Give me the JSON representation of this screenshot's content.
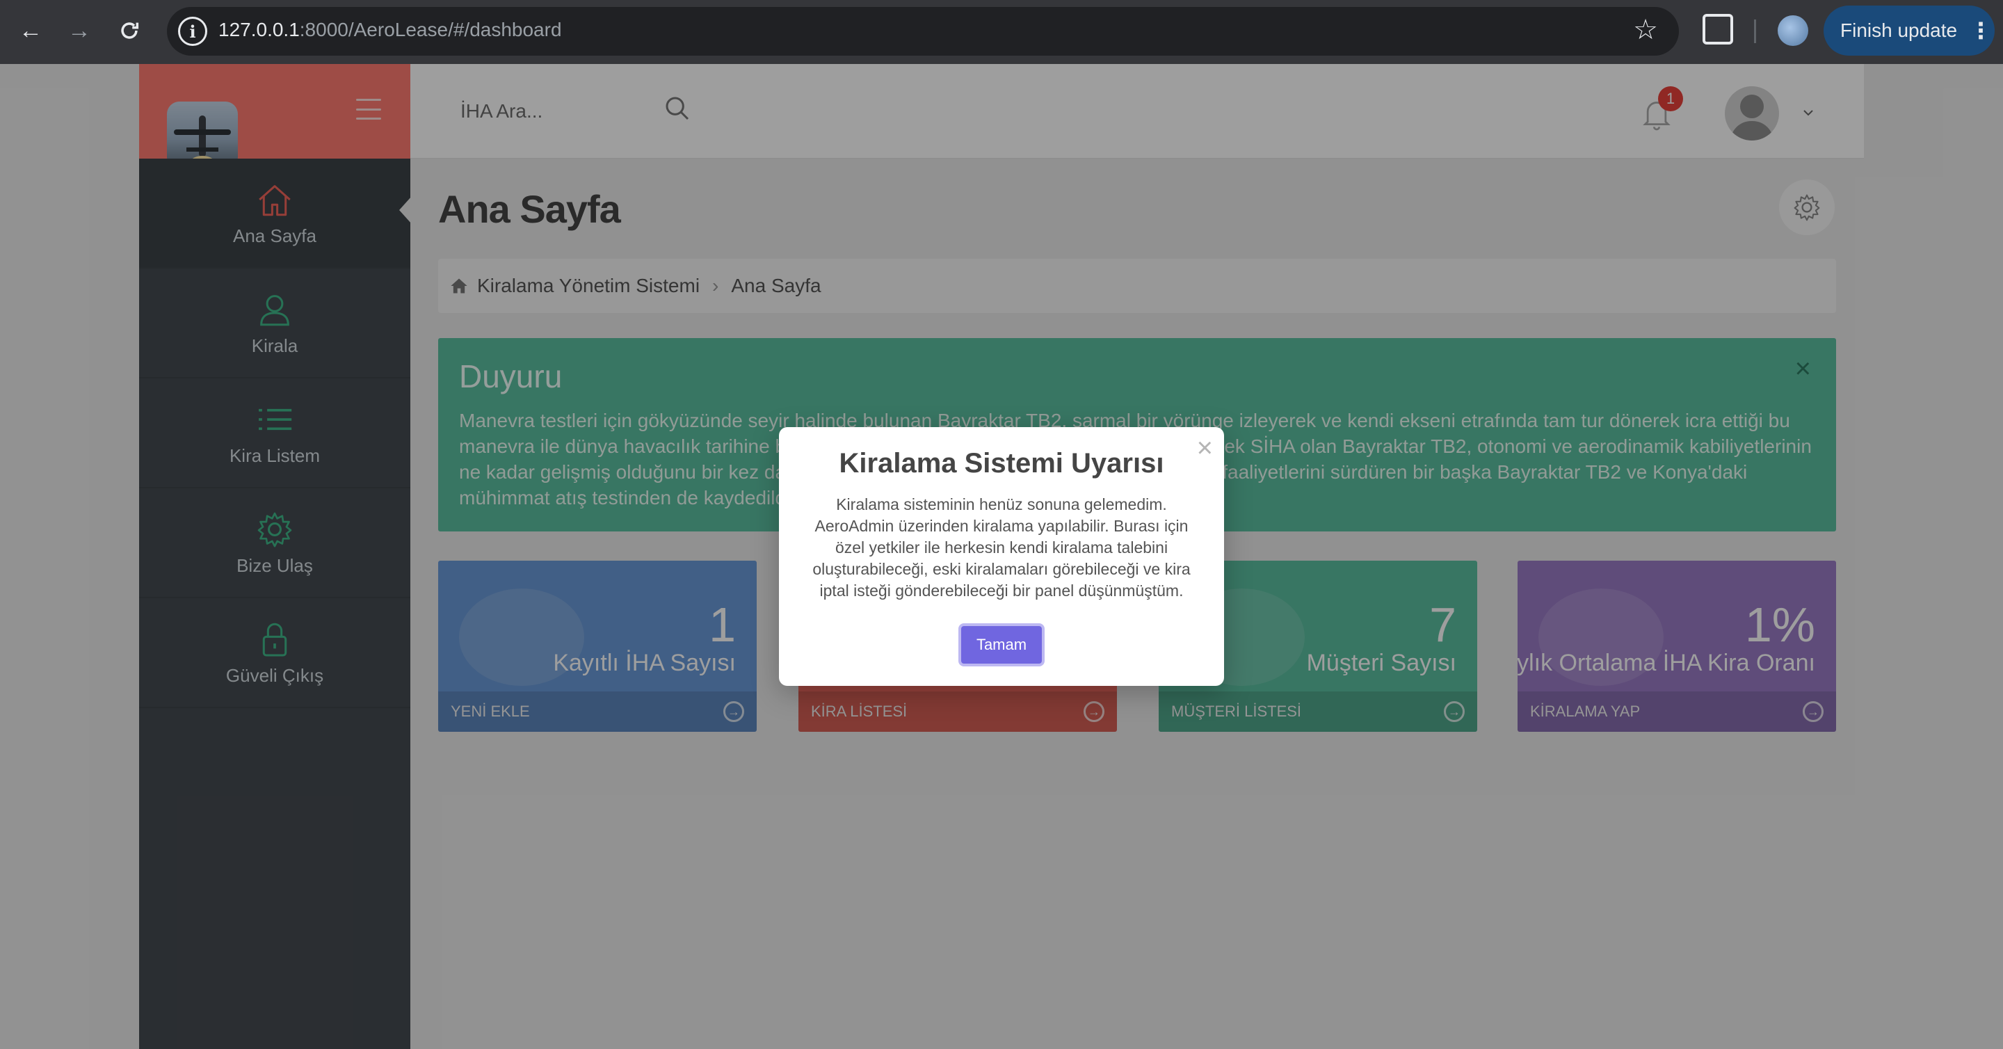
{
  "browser": {
    "url_host": "127.0.0.1",
    "url_rest": ":8000/AeroLease/#/dashboard",
    "update_label": "Finish update"
  },
  "search": {
    "placeholder": "İHA Ara..."
  },
  "notifications": {
    "count": "1"
  },
  "sidebar": {
    "items": [
      {
        "label": "Ana Sayfa",
        "icon": "home-icon",
        "active": true
      },
      {
        "label": "Kirala",
        "icon": "user-icon"
      },
      {
        "label": "Kira Listem",
        "icon": "list-icon"
      },
      {
        "label": "Bize Ulaş",
        "icon": "gear-icon"
      },
      {
        "label": "Güveli Çıkış",
        "icon": "lock-icon"
      }
    ]
  },
  "page": {
    "title": "Ana Sayfa",
    "breadcrumb": {
      "root": "Kiralama Yönetim Sistemi",
      "current": "Ana Sayfa"
    }
  },
  "notice": {
    "title": "Duyuru",
    "text": "Manevra testleri için gökyüzünde seyir halinde bulunan Bayraktar TB2, sarmal bir yörünge izleyerek ve kendi ekseni etrafında tam tur dönerek icra ettiği bu manevra ile dünya havacılık tarihine bir ilk daha yazdırdı. Bu manevrayı yapabilen ilk ve tek SİHA olan Bayraktar TB2, otonomi ve aerodinamik kabiliyetlerinin ne kadar gelişmiş olduğunu bir kez daha gösterdi. Manevranın ilgi çekici anlarını ise test faaliyetlerini sürdüren bir başka Bayraktar TB2 ve Konya'daki mühimmat atış testinden de kaydedildi."
  },
  "stats": [
    {
      "value": "1",
      "label": "Kayıtlı İHA Sayısı",
      "link": "YENİ EKLE",
      "color": "#6a9ad8"
    },
    {
      "value": "",
      "label": "",
      "link": "KİRA LİSTESİ",
      "color": "#f26b61"
    },
    {
      "value": "7",
      "label": "Müşteri Sayısı",
      "link": "MÜŞTERİ LİSTESİ",
      "color": "#5bbea0"
    },
    {
      "value": "1%",
      "label": "Aylık Ortalama İHA Kira Oranı",
      "link": "KİRALAMA YAP",
      "color": "#9a7bc6"
    }
  ],
  "modal": {
    "title": "Kiralama Sistemi Uyarısı",
    "text": "Kiralama sisteminin henüz sonuna gelemedim. AeroAdmin üzerinden kiralama yapılabilir. Burası için özel yetkiler ile herkesin kendi kiralama talebini oluşturabileceği, eski kiralamaları görebileceği ve kira iptal isteği gönderebileceği bir panel düşünmüştüm.",
    "ok_label": "Tamam"
  }
}
